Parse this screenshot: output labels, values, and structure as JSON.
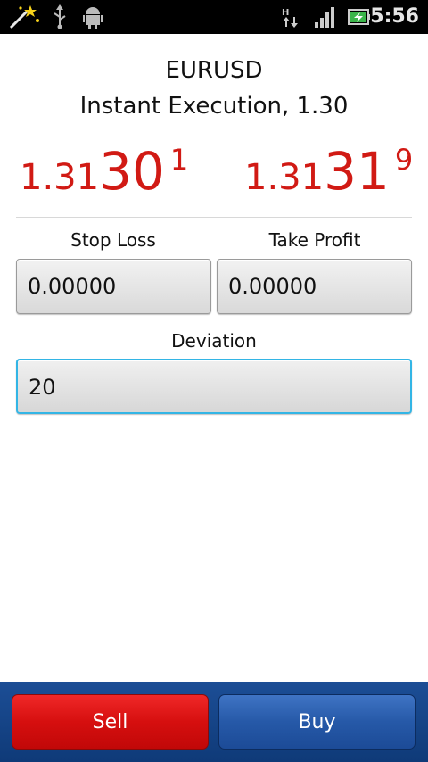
{
  "status_bar": {
    "time": "5:56",
    "left_icons": [
      "magic-wand-icon",
      "usb-icon",
      "android-debug-icon"
    ],
    "right_icons": [
      "data-transfer-icon",
      "signal-icon",
      "battery-icon"
    ]
  },
  "order": {
    "symbol": "EURUSD",
    "execution": "Instant Execution, 1.30"
  },
  "quotes": {
    "bid": {
      "base": "1.31",
      "big": "30",
      "sup": "1"
    },
    "ask": {
      "base": "1.31",
      "big": "31",
      "sup": "9"
    },
    "color": "#d11a14"
  },
  "fields": {
    "stop_loss": {
      "label": "Stop Loss",
      "value": "0.00000"
    },
    "take_profit": {
      "label": "Take Profit",
      "value": "0.00000"
    },
    "deviation": {
      "label": "Deviation",
      "value": "20"
    }
  },
  "actions": {
    "sell_label": "Sell",
    "buy_label": "Buy",
    "sell_color": "#d60f0f",
    "buy_color": "#2659a8"
  }
}
